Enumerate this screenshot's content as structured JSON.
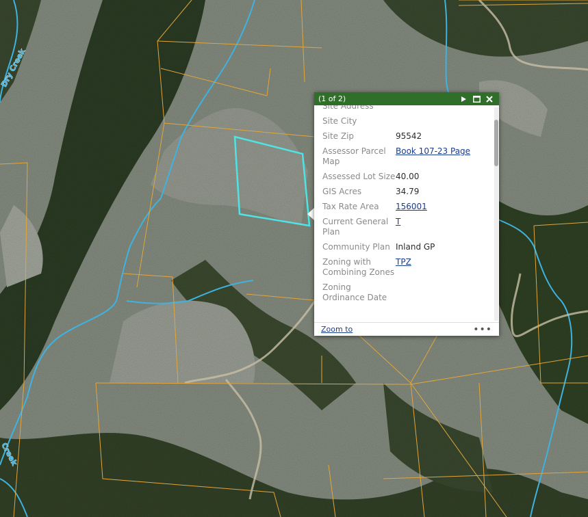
{
  "map": {
    "creek_labels": [
      "Dry Creek",
      "Creek"
    ],
    "colors": {
      "parcel_line": "#e3a63a",
      "stream": "#3fb3e0",
      "selected_parcel": "#4fe3e3",
      "road": "#c8bfa6",
      "forest": "#3b4a32",
      "slope": "#8e958a"
    }
  },
  "popup": {
    "title": "(1 of 2)",
    "header_color": "#2f6f2a",
    "icons": [
      "next-icon",
      "maximize-icon",
      "close-icon"
    ],
    "rows": [
      {
        "label": "Site Address",
        "value": ""
      },
      {
        "label": "Site City",
        "value": ""
      },
      {
        "label": "Site Zip",
        "value": "95542"
      },
      {
        "label": "Assessor Parcel Map",
        "value": "Book 107-23 Page",
        "link": true
      },
      {
        "label": "Assessed Lot Size",
        "value": "40.00"
      },
      {
        "label": "GIS Acres",
        "value": "34.79"
      },
      {
        "label": "Tax Rate Area",
        "value": "156001",
        "link": true
      },
      {
        "label": "Current General Plan",
        "value": "T",
        "link": true
      },
      {
        "label": "Community Plan",
        "value": "Inland GP"
      },
      {
        "label": "Zoning with Combining Zones",
        "value": "TPZ",
        "link": true
      },
      {
        "label": "Zoning Ordinance Date",
        "value": ""
      }
    ],
    "footer": {
      "zoom_label": "Zoom to",
      "more_label": "•••"
    }
  }
}
